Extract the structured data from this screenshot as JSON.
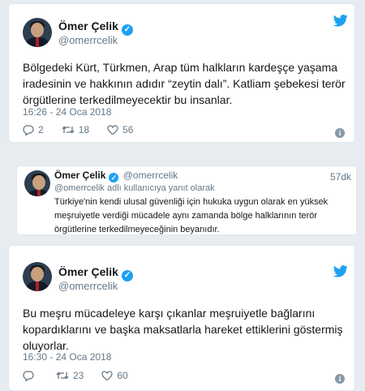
{
  "tweet1": {
    "name": "Ömer Çelik",
    "handle": "@omerrcelik",
    "text": "Bölgedeki Kürt, Türkmen, Arap tüm halkların  kardeşçe yaşama iradesinin ve hakkının adıdır “zeytin dalı”. Katliam şebekesi terör örgütlerine terkedilmeyecektir bu insanlar.",
    "time": "16:26 - 24 Oca 2018",
    "replies": "2",
    "retweets": "18",
    "likes": "56"
  },
  "quoted": {
    "name": "Ömer Çelik",
    "handle": "@omerrcelik",
    "ago": "57dk",
    "replying_to": "@omerrcelik adlı kullanıcıya yanıt olarak",
    "text": "Türkiye'nin kendi ulusal güvenliği için hukuka uygun olarak en yüksek meşruiyetle verdiği mücadele aynı zamanda bölge halklarının terör örgütlerine terkedilmeyeceğinin beyanıdır."
  },
  "tweet2": {
    "name": "Ömer Çelik",
    "handle": "@omerrcelik",
    "text": "Bu meşru mücadeleye karşı çıkanlar meşruiyetle bağlarını kopardıklarını ve başka maksatlarla hareket ettiklerini göstermiş oluyorlar.",
    "time": "16:30 - 24 Oca 2018",
    "retweets": "23",
    "likes": "60"
  },
  "colors": {
    "accent": "#1da1f2",
    "muted": "#657786",
    "border": "#e1e8ed"
  },
  "icons": [
    "verified-badge-icon",
    "twitter-bird-icon",
    "reply-icon",
    "retweet-icon",
    "heart-icon",
    "info-icon"
  ]
}
